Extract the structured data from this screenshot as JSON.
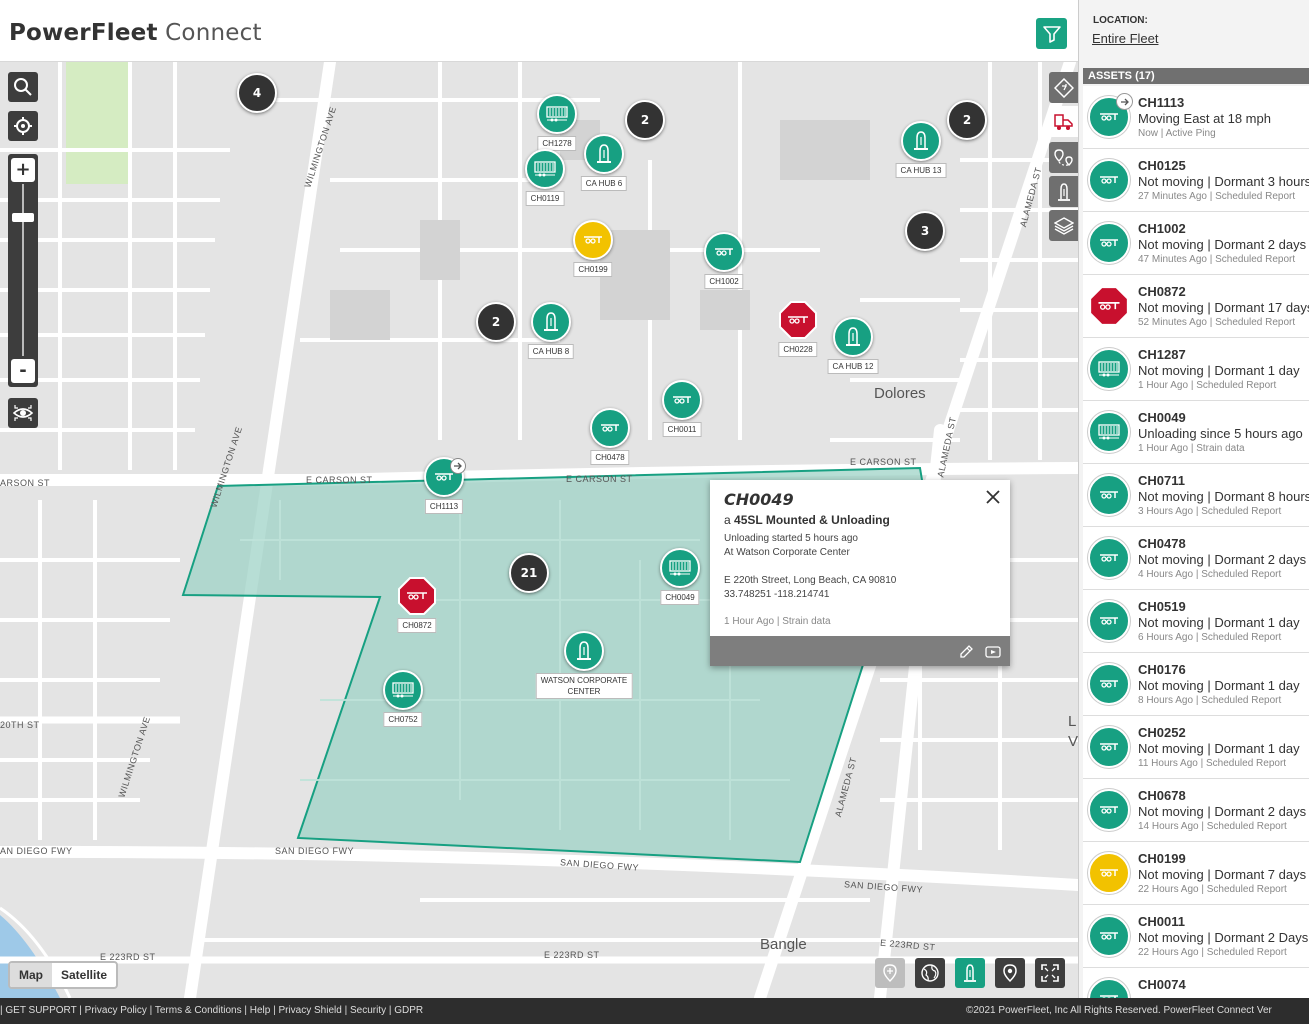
{
  "brand": {
    "bold": "PowerFleet",
    "light": "Connect"
  },
  "location": {
    "label": "LOCATION:",
    "value": "Entire Fleet"
  },
  "assets_header": "ASSETS (17)",
  "assets": [
    {
      "name": "CH1113",
      "status": "Moving East at 18 mph",
      "meta": "Now | Active Ping",
      "color": "green",
      "kind": "chassis",
      "moving": true
    },
    {
      "name": "CH0125",
      "status": "Not moving | Dormant 3 hours",
      "meta": "27 Minutes Ago | Scheduled Report",
      "color": "green",
      "kind": "chassis"
    },
    {
      "name": "CH1002",
      "status": "Not moving | Dormant 2 days",
      "meta": "47 Minutes Ago | Scheduled Report",
      "color": "green",
      "kind": "chassis"
    },
    {
      "name": "CH0872",
      "status": "Not moving | Dormant 17 days",
      "meta": "52 Minutes Ago | Scheduled Report",
      "color": "red",
      "kind": "chassis"
    },
    {
      "name": "CH1287",
      "status": "Not moving | Dormant 1 day",
      "meta": "1 Hour Ago | Scheduled Report",
      "color": "green",
      "kind": "container"
    },
    {
      "name": "CH0049",
      "status": "Unloading since 5 hours ago",
      "meta": "1 Hour Ago | Strain data",
      "color": "green",
      "kind": "container"
    },
    {
      "name": "CH0711",
      "status": "Not moving | Dormant 8 hours",
      "meta": "3 Hours Ago | Scheduled Report",
      "color": "green",
      "kind": "chassis"
    },
    {
      "name": "CH0478",
      "status": "Not moving | Dormant 2 days",
      "meta": "4 Hours Ago | Scheduled Report",
      "color": "green",
      "kind": "chassis"
    },
    {
      "name": "CH0519",
      "status": "Not moving | Dormant 1 day",
      "meta": "6 Hours Ago | Scheduled Report",
      "color": "green",
      "kind": "chassis"
    },
    {
      "name": "CH0176",
      "status": "Not moving | Dormant 1 day",
      "meta": "8 Hours Ago | Scheduled Report",
      "color": "green",
      "kind": "chassis"
    },
    {
      "name": "CH0252",
      "status": "Not moving | Dormant 1 day",
      "meta": "11 Hours Ago | Scheduled Report",
      "color": "green",
      "kind": "chassis"
    },
    {
      "name": "CH0678",
      "status": "Not moving | Dormant 2 days",
      "meta": "14 Hours Ago | Scheduled Report",
      "color": "green",
      "kind": "chassis"
    },
    {
      "name": "CH0199",
      "status": "Not moving | Dormant 7 days",
      "meta": "22 Hours Ago | Scheduled Report",
      "color": "yellow",
      "kind": "chassis"
    },
    {
      "name": "CH0011",
      "status": "Not moving | Dormant 2 Days",
      "meta": "22 Hours Ago | Scheduled Report",
      "color": "green",
      "kind": "chassis"
    },
    {
      "name": "CH0074",
      "status": "",
      "meta": "",
      "color": "green",
      "kind": "chassis"
    }
  ],
  "map": {
    "streets": {
      "wilmington_1": "WILMINGTON AVE",
      "wilmington_2": "WILMINGTON AVE",
      "wilmington_3": "WILMINGTON AVE",
      "carson_1": "E CARSON ST",
      "carson_2": "E CARSON ST",
      "carson_3": "E CARSON ST",
      "carson_left": "ARSON ST",
      "alameda_1": "ALAMEDA ST",
      "alameda_2": "ALAMEDA ST",
      "alameda_3": "ALAMEDA ST",
      "st220": "20TH ST",
      "sandiego_left": "AN DIEGO FWY",
      "sandiego_1": "SAN DIEGO FWY",
      "sandiego_2": "SAN DIEGO FWY",
      "sandiego_3": "SAN DIEGO FWY",
      "e223_1": "E 223RD ST",
      "e223_2": "E 223RD ST",
      "e223_3": "E 223RD ST"
    },
    "places": {
      "dolores": "Dolores",
      "bangle": "Bangle",
      "l": "L",
      "v": "V"
    },
    "clusters": [
      "4",
      "2",
      "2",
      "3",
      "2",
      "21"
    ],
    "markers": {
      "ch1278": "CH1278",
      "cahub6": "CA HUB 6",
      "ch0119": "CH0119",
      "ch0199": "CH0199",
      "ch1002": "CH1002",
      "cahub13": "CA HUB 13",
      "cahub8": "CA HUB 8",
      "ch0228": "CH0228",
      "cahub12": "CA HUB 12",
      "ch0011": "CH0011",
      "ch0478": "CH0478",
      "ch1113": "CH1113",
      "ch0872": "CH0872",
      "ch0049": "CH0049",
      "watson1": "WATSON CORPORATE",
      "watson2": "CENTER",
      "ch0752": "CH0752"
    },
    "maptype": {
      "map": "Map",
      "satellite": "Satellite"
    },
    "zoom": {
      "plus": "+",
      "minus": "-"
    }
  },
  "popup": {
    "title": "CH0049",
    "sub_prefix": "a",
    "sub_bold": "45SL Mounted & Unloading",
    "line1": "Unloading started 5 hours ago",
    "line2": "At Watson Corporate Center",
    "address": "E 220th Street, Long Beach, CA 90810",
    "coords": "33.748251   -118.214741",
    "meta": "1 Hour Ago | Strain data"
  },
  "footer": {
    "left": "| GET SUPPORT | Privacy Policy | Terms & Conditions | Help | Privacy Shield | Security | GDPR",
    "right": "©2021 PowerFleet, Inc  All Rights Reserved.   PowerFleet Connect Ver"
  },
  "colors": {
    "accent": "#17a082",
    "yellow": "#f2c200",
    "red": "#c8102e",
    "geofence": "#9fd3c7"
  },
  "icons": {
    "search": "search-icon",
    "locate": "crosshair-icon",
    "visibility": "eye-icon",
    "filter": "funnel-icon",
    "chassis": "chassis-icon",
    "container": "container-icon",
    "hub": "hub-icon",
    "layers": "layers-icon"
  }
}
